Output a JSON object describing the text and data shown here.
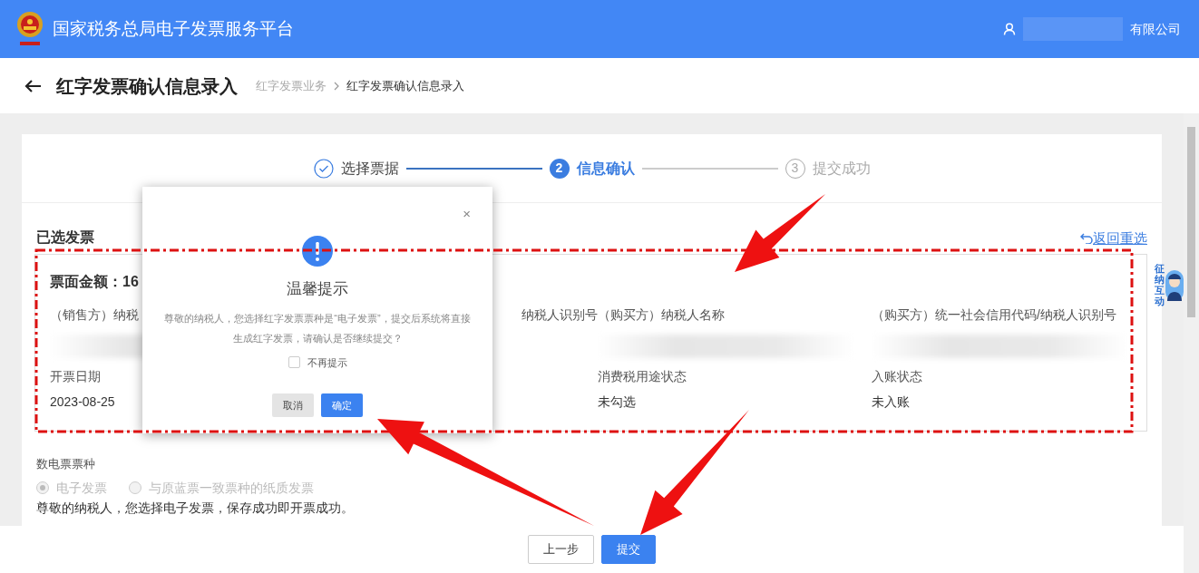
{
  "header": {
    "title": "国家税务总局电子发票服务平台",
    "user": "有限公司"
  },
  "page": {
    "title": "红字发票确认信息录入",
    "breadcrumbs": [
      {
        "label": "红字发票业务",
        "current": false
      },
      {
        "label": "红字发票确认信息录入",
        "current": true
      }
    ]
  },
  "steps": [
    {
      "label": "选择票据",
      "done": true,
      "active": false
    },
    {
      "number": "2",
      "label": "信息确认",
      "done": false,
      "active": true
    },
    {
      "number": "3",
      "label": "提交成功",
      "done": false,
      "active": false
    }
  ],
  "section": {
    "title": "已选发票",
    "action": "返回重选"
  },
  "invoice": {
    "amount": "票面金额：16",
    "fields": [
      {
        "kind": "start",
        "label": "（销售方）纳税",
        "redacted": true
      },
      {
        "kind": "end",
        "label": "纳税人识别号"
      },
      {
        "kind": "start",
        "label": "（购买方）纳税人名称",
        "redacted": true
      },
      {
        "kind": "start",
        "label": "（购买方）统一社会信用代码/纳税人识别号",
        "redacted": true
      },
      {
        "kind": "start",
        "label": "开票日期",
        "value": "2023-08-25"
      },
      {
        "kind": "covered"
      },
      {
        "kind": "start",
        "label": "消费税用途状态",
        "value": "未勾选"
      },
      {
        "kind": "start",
        "label": "入账状态",
        "value": "未入账"
      }
    ]
  },
  "ticket_type": {
    "label": "数电票票种",
    "options": [
      {
        "label": "电子发票",
        "selected": true,
        "disabled": true
      },
      {
        "label": "与原蓝票一致票种的纸质发票",
        "selected": false,
        "disabled": true
      }
    ],
    "note": "尊敬的纳税人，您选择电子发票，保存成功即开票成功。"
  },
  "footer": {
    "buttons": [
      {
        "label": "上一步",
        "primary": false
      },
      {
        "label": "提交",
        "primary": true
      }
    ]
  },
  "modal": {
    "close": "×",
    "title": "温馨提示",
    "message": "尊敬的纳税人，您选择红字发票票种是“电子发票”，提交后系统将直接生成红字发票，请确认是否继续提交？",
    "checkbox": {
      "label": "不再提示",
      "checked": false
    },
    "buttons": [
      {
        "label": "取消",
        "primary": false
      },
      {
        "label": "确定",
        "primary": true
      }
    ]
  },
  "assistant": {
    "label": "征纳互动"
  }
}
